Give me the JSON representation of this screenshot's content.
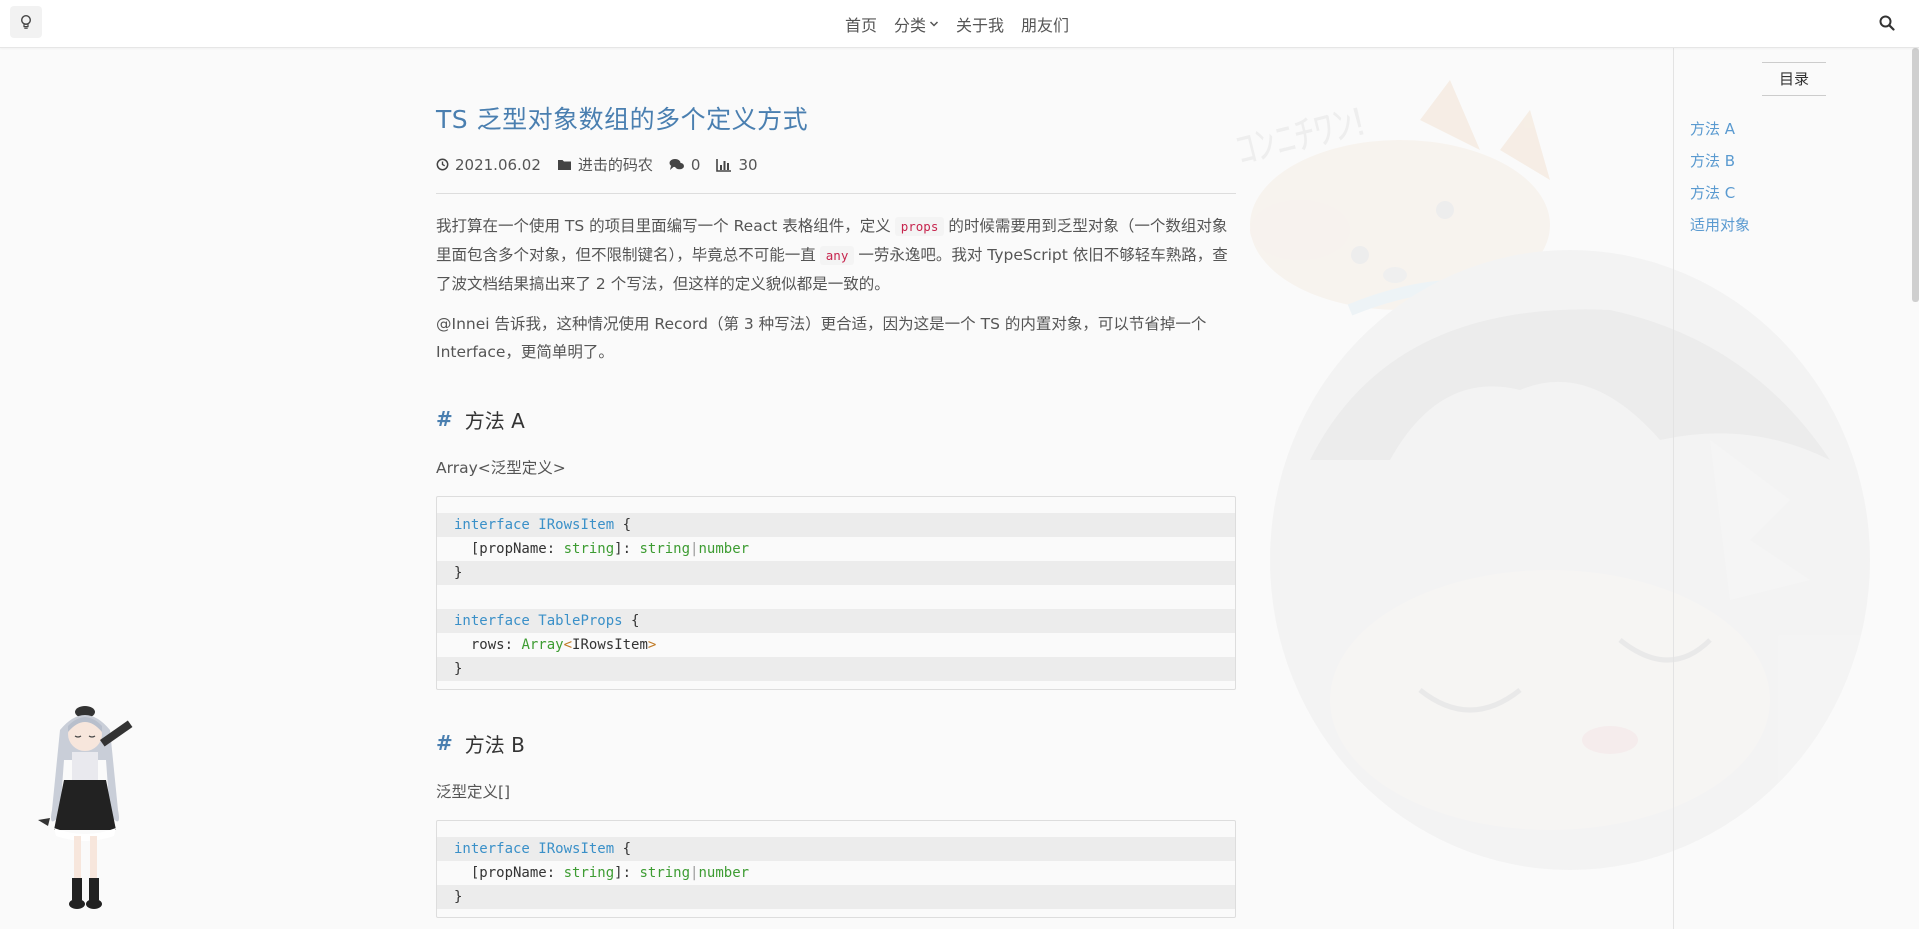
{
  "nav": {
    "items": [
      "首页",
      "分类",
      "关于我",
      "朋友们"
    ]
  },
  "article": {
    "title": "TS 乏型对象数组的多个定义方式",
    "meta": {
      "date": "2021.06.02",
      "category": "进击的码农",
      "comments": "0",
      "views": "30"
    },
    "intro": {
      "p1_a": "我打算在一个使用 TS 的项目里面编写一个 React 表格组件，定义",
      "p1_code1": "props",
      "p1_b": "的时候需要用到乏型对象（一个数组对象里面包含多个对象，但不限制键名），毕竟总不可能一直",
      "p1_code2": "any",
      "p1_c": "一劳永逸吧。我对 TypeScript 依旧不够轻车熟路，查了波文档结果搞出来了 2 个写法，但这样的定义貌似都是一致的。",
      "p2": "@Innei 告诉我，这种情况使用 Record（第 3 种写法）更合适，因为这是一个 TS 的内置对象，可以节省掉一个 Interface，更简单明了。"
    },
    "sections": [
      {
        "hash": "#",
        "heading": "方法 A",
        "type_label": "Array<泛型定义>",
        "code": {
          "l1_kw": "interface",
          "l1_name": "IRowsItem",
          "l1_brace": "{",
          "l2_key": "[propName",
          "l2_colon": ":",
          "l2_type": "string",
          "l2_rest": "]:",
          "l2_t1": "string",
          "l2_pipe": "|",
          "l2_t2": "number",
          "l3": "}",
          "l5_kw": "interface",
          "l5_name": "TableProps",
          "l5_brace": "{",
          "l6_key": "rows",
          "l6_colon": ":",
          "l6_arr": "Array",
          "l6_lt": "<",
          "l6_item": "IRowsItem",
          "l6_gt": ">",
          "l7": "}"
        }
      },
      {
        "hash": "#",
        "heading": "方法 B",
        "type_label": "泛型定义[]",
        "code": {
          "l1_kw": "interface",
          "l1_name": "IRowsItem",
          "l1_brace": "{",
          "l2_key": "[propName",
          "l2_colon": ":",
          "l2_type": "string",
          "l2_rest": "]:",
          "l2_t1": "string",
          "l2_pipe": "|",
          "l2_t2": "number",
          "l3": "}"
        }
      }
    ]
  },
  "toc": {
    "title": "目录",
    "items": [
      "方法 A",
      "方法 B",
      "方法 C",
      "适用对象"
    ]
  },
  "icons": {
    "bulb": "lightbulb-icon",
    "search": "search-icon",
    "chevron": "chevron-down-icon",
    "clock": "clock-icon",
    "folder": "folder-icon",
    "comments": "comments-icon",
    "views": "bar-chart-icon"
  },
  "colors": {
    "accent": "#4a7fb0",
    "toc_link": "#5a9ad0",
    "inline_code": "#c7254e"
  }
}
